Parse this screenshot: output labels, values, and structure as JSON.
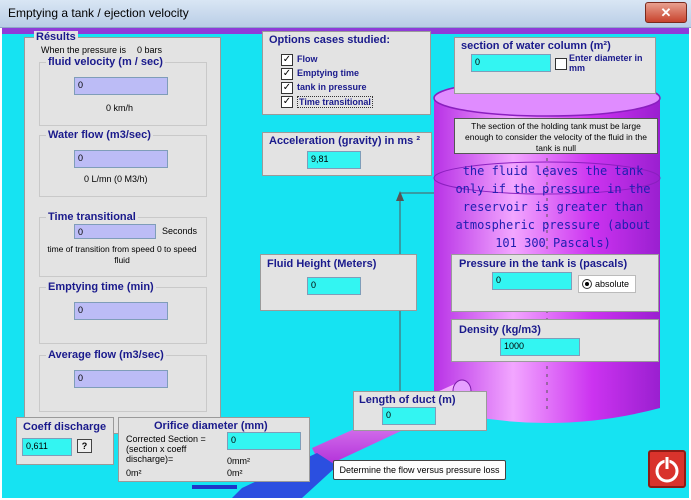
{
  "window": {
    "title": "Emptying a tank /  ejection velocity",
    "close_icon": "close-icon"
  },
  "results": {
    "title": "Résults",
    "pressure_prefix": "When the pressure is",
    "pressure_value": "0 bars",
    "fluid_velocity": {
      "title": "fluid velocity (m / sec)",
      "value": "0",
      "kmh": "0 km/h"
    },
    "water_flow": {
      "title": "Water flow (m3/sec)",
      "value": "0",
      "lmin": "0 L/mn (0 M3/h)"
    },
    "time_transitional": {
      "title": "Time transitional",
      "value": "0",
      "unit": "Seconds",
      "desc": "time of transition from speed 0 to speed fluid"
    },
    "emptying_time": {
      "title": "Emptying time (min)",
      "value": "0"
    },
    "average_flow": {
      "title": "Average flow (m3/sec)",
      "value": "0"
    }
  },
  "options": {
    "title": "Options cases studied:",
    "items": [
      {
        "label": "Flow",
        "checked": "✓"
      },
      {
        "label": "Emptying time",
        "checked": "✓"
      },
      {
        "label": "tank in pressure",
        "checked": "✓"
      },
      {
        "label": "Time transitional",
        "checked": "✓"
      }
    ]
  },
  "acceleration": {
    "title": "Acceleration (gravity) in ms ²",
    "value": "9,81"
  },
  "fluid_height": {
    "title": "Fluid Height (Meters)",
    "value": "0"
  },
  "length_duct": {
    "title": "Length of duct (m)",
    "value": "0"
  },
  "section": {
    "title": "section of water column (m²)",
    "value": "0",
    "enter_diameter": "Enter diameter in mm",
    "note": "The section of the holding tank must be large enough to consider the velocity of the fluid in the tank is null"
  },
  "message": "the fluid leaves the tank only if the pressure in the reservoir is greater than atmospheric pressure (about 101 300 Pascals)",
  "pressure_tank": {
    "title": "Pressure in the tank is (pascals)",
    "value": "0",
    "mode": "absolute"
  },
  "density": {
    "title": "Density (kg/m3)",
    "value": "1000"
  },
  "coeff": {
    "title": "Coeff discharge",
    "value": "0,611",
    "help": "?"
  },
  "orifice": {
    "title": "Orifice diameter (mm)",
    "corrected_label": "Corrected Section = (section x coeff discharge)=",
    "value": "0",
    "mm2": "0mm²",
    "m2_left": "0m²",
    "m2_right": "0m²"
  },
  "flow_button": "Determine the flow versus pressure loss",
  "power_icon": "power-icon",
  "colors": {
    "background": "#16e3f2",
    "panel": "#e3e3e3",
    "input_lavender": "#bcbcf6",
    "input_cyan": "#33f5f2",
    "tank": "#cc33f0",
    "accent_title": "#1a1a8c"
  }
}
